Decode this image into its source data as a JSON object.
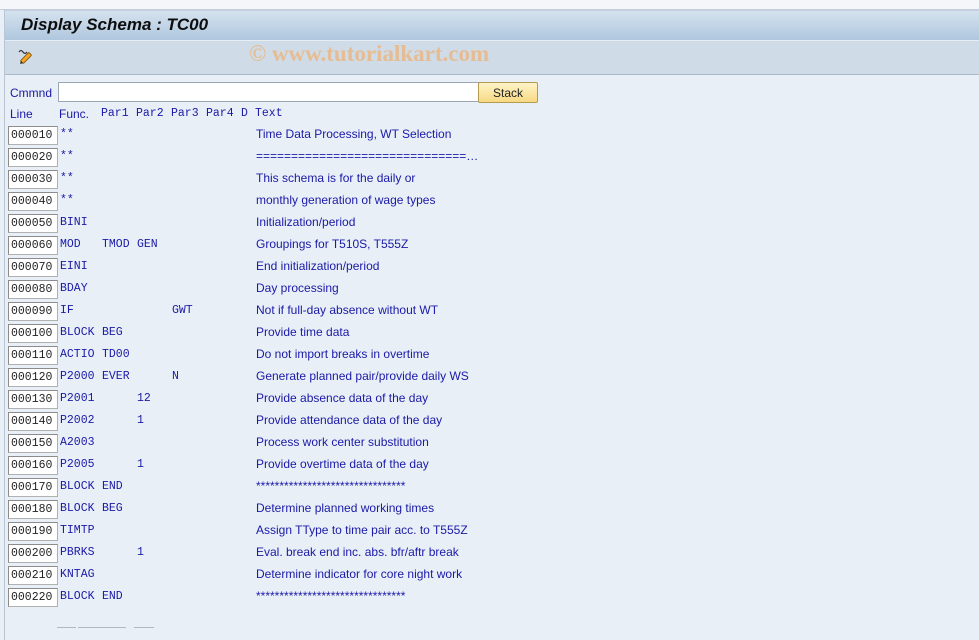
{
  "window": {
    "title": "Display Schema : TC00",
    "watermark": "© www.tutorialkart.com"
  },
  "toolbar": {
    "icons": [
      "display-change-icon"
    ]
  },
  "command": {
    "label": "Cmmnd",
    "value": "",
    "placeholder": "",
    "button_label": "Stack"
  },
  "columns": {
    "line": "Line",
    "func": "Func.",
    "par1": "Par1",
    "par2": "Par2",
    "par3": "Par3",
    "par4": "Par4",
    "d": "D",
    "text": "Text"
  },
  "rows": [
    {
      "line": "000010",
      "func": "**",
      "par1": "",
      "par2": "",
      "par3": "",
      "par4": "",
      "d": "",
      "text": "Time Data Processing, WT Selection"
    },
    {
      "line": "000020",
      "func": "**",
      "par1": "",
      "par2": "",
      "par3": "",
      "par4": "",
      "d": "",
      "text": "==============================…"
    },
    {
      "line": "000030",
      "func": "**",
      "par1": "",
      "par2": "",
      "par3": "",
      "par4": "",
      "d": "",
      "text": "This schema is for the daily or"
    },
    {
      "line": "000040",
      "func": "**",
      "par1": "",
      "par2": "",
      "par3": "",
      "par4": "",
      "d": "",
      "text": "monthly generation of wage types"
    },
    {
      "line": "000050",
      "func": "BINI",
      "par1": "",
      "par2": "",
      "par3": "",
      "par4": "",
      "d": "",
      "text": "Initialization/period"
    },
    {
      "line": "000060",
      "func": "MOD",
      "par1": "TMOD",
      "par2": "GEN",
      "par3": "",
      "par4": "",
      "d": "",
      "text": "Groupings for T510S, T555Z"
    },
    {
      "line": "000070",
      "func": "EINI",
      "par1": "",
      "par2": "",
      "par3": "",
      "par4": "",
      "d": "",
      "text": "End initialization/period"
    },
    {
      "line": "000080",
      "func": "BDAY",
      "par1": "",
      "par2": "",
      "par3": "",
      "par4": "",
      "d": "",
      "text": "Day processing"
    },
    {
      "line": "000090",
      "func": "IF",
      "par1": "",
      "par2": "",
      "par3": "GWT",
      "par4": "",
      "d": "",
      "text": "Not if full-day absence without WT"
    },
    {
      "line": "000100",
      "func": "BLOCK",
      "par1": "BEG",
      "par2": "",
      "par3": "",
      "par4": "",
      "d": "",
      "text": "Provide time data"
    },
    {
      "line": "000110",
      "func": "ACTIO",
      "par1": "TD00",
      "par2": "",
      "par3": "",
      "par4": "",
      "d": "",
      "text": "Do not import breaks in overtime"
    },
    {
      "line": "000120",
      "func": "P2000",
      "par1": "EVER",
      "par2": "",
      "par3": "N",
      "par4": "",
      "d": "",
      "text": "Generate planned pair/provide daily WS"
    },
    {
      "line": "000130",
      "func": "P2001",
      "par1": "",
      "par2": "12",
      "par3": "",
      "par4": "",
      "d": "",
      "text": "Provide absence data of the day"
    },
    {
      "line": "000140",
      "func": "P2002",
      "par1": "",
      "par2": "1",
      "par3": "",
      "par4": "",
      "d": "",
      "text": "Provide attendance data of the day"
    },
    {
      "line": "000150",
      "func": "A2003",
      "par1": "",
      "par2": "",
      "par3": "",
      "par4": "",
      "d": "",
      "text": "Process work center substitution"
    },
    {
      "line": "000160",
      "func": "P2005",
      "par1": "",
      "par2": "1",
      "par3": "",
      "par4": "",
      "d": "",
      "text": "Provide overtime data of the day"
    },
    {
      "line": "000170",
      "func": "BLOCK",
      "par1": "END",
      "par2": "",
      "par3": "",
      "par4": "",
      "d": "",
      "text": "********************************"
    },
    {
      "line": "000180",
      "func": "BLOCK",
      "par1": "BEG",
      "par2": "",
      "par3": "",
      "par4": "",
      "d": "",
      "text": "Determine planned working times"
    },
    {
      "line": "000190",
      "func": "TIMTP",
      "par1": "",
      "par2": "",
      "par3": "",
      "par4": "",
      "d": "",
      "text": "Assign TType to time pair acc. to T555Z"
    },
    {
      "line": "000200",
      "func": "PBRKS",
      "par1": "",
      "par2": "1",
      "par3": "",
      "par4": "",
      "d": "",
      "text": "Eval. break end inc. abs. bfr/aftr break"
    },
    {
      "line": "000210",
      "func": "KNTAG",
      "par1": "",
      "par2": "",
      "par3": "",
      "par4": "",
      "d": "",
      "text": "Determine indicator for core night work"
    },
    {
      "line": "000220",
      "func": "BLOCK",
      "par1": "END",
      "par2": "",
      "par3": "",
      "par4": "",
      "d": "",
      "text": "********************************"
    }
  ],
  "colors": {
    "text_blue": "#1a1aa6",
    "background": "#e8eff7",
    "button_yellow": "#f7d983"
  }
}
